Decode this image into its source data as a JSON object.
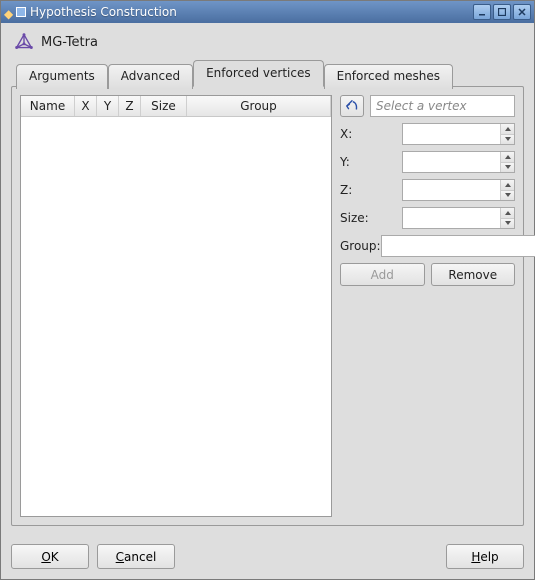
{
  "window": {
    "title": "Hypothesis Construction"
  },
  "module": {
    "name": "MG-Tetra"
  },
  "tabs": {
    "arguments": "Arguments",
    "advanced": "Advanced",
    "enforced_vertices": "Enforced vertices",
    "enforced_meshes": "Enforced meshes"
  },
  "table": {
    "headers": {
      "name": "Name",
      "x": "X",
      "y": "Y",
      "z": "Z",
      "size": "Size",
      "group": "Group"
    },
    "rows": []
  },
  "side": {
    "vertex_placeholder": "Select a vertex",
    "labels": {
      "x": "X:",
      "y": "Y:",
      "z": "Z:",
      "size": "Size:",
      "group": "Group:"
    },
    "values": {
      "x": "",
      "y": "",
      "z": "",
      "size": "",
      "group": ""
    },
    "buttons": {
      "add": "Add",
      "remove": "Remove"
    }
  },
  "footer": {
    "ok": "OK",
    "cancel": "Cancel",
    "help": "Help"
  }
}
